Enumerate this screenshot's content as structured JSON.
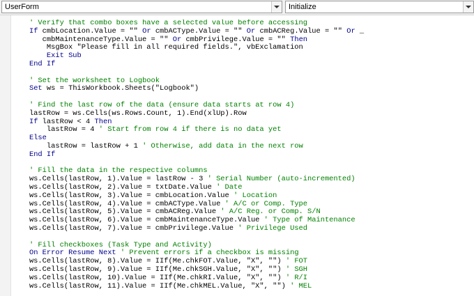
{
  "object_box": {
    "value": "UserForm"
  },
  "procedure_box": {
    "value": "Initialize"
  },
  "code_lines": [
    [
      {
        "t": "    "
      },
      {
        "t": "' Verify that combo boxes have a selected value before accessing",
        "c": "cm"
      }
    ],
    [
      {
        "t": "    "
      },
      {
        "t": "If",
        "c": "kw"
      },
      {
        "t": " cmbLocation.Value = \"\" "
      },
      {
        "t": "Or",
        "c": "kw"
      },
      {
        "t": " cmbACType.Value = \"\" "
      },
      {
        "t": "Or",
        "c": "kw"
      },
      {
        "t": " cmbACReg.Value = \"\" "
      },
      {
        "t": "Or",
        "c": "kw"
      },
      {
        "t": " _"
      }
    ],
    [
      {
        "t": "       cmbMaintenanceType.Value = \"\" "
      },
      {
        "t": "Or",
        "c": "kw"
      },
      {
        "t": " cmbPrivilege.Value = \"\" "
      },
      {
        "t": "Then",
        "c": "kw"
      }
    ],
    [
      {
        "t": "        MsgBox \"Please fill in all required fields.\", vbExclamation"
      }
    ],
    [
      {
        "t": "        "
      },
      {
        "t": "Exit Sub",
        "c": "kw"
      }
    ],
    [
      {
        "t": "    "
      },
      {
        "t": "End If",
        "c": "kw"
      }
    ],
    [
      {
        "t": ""
      }
    ],
    [
      {
        "t": "    "
      },
      {
        "t": "' Set the worksheet to Logbook",
        "c": "cm"
      }
    ],
    [
      {
        "t": "    "
      },
      {
        "t": "Set",
        "c": "kw"
      },
      {
        "t": " ws = ThisWorkbook.Sheets(\"Logbook\")"
      }
    ],
    [
      {
        "t": ""
      }
    ],
    [
      {
        "t": "    "
      },
      {
        "t": "' Find the last row of the data (ensure data starts at row 4)",
        "c": "cm"
      }
    ],
    [
      {
        "t": "    lastRow = ws.Cells(ws.Rows.Count, 1).End(xlUp).Row"
      }
    ],
    [
      {
        "t": "    "
      },
      {
        "t": "If",
        "c": "kw"
      },
      {
        "t": " lastRow < 4 "
      },
      {
        "t": "Then",
        "c": "kw"
      }
    ],
    [
      {
        "t": "        lastRow = 4 "
      },
      {
        "t": "' Start from row 4 if there is no data yet",
        "c": "cm"
      }
    ],
    [
      {
        "t": "    "
      },
      {
        "t": "Else",
        "c": "kw"
      }
    ],
    [
      {
        "t": "        lastRow = lastRow + 1 "
      },
      {
        "t": "' Otherwise, add data in the next row",
        "c": "cm"
      }
    ],
    [
      {
        "t": "    "
      },
      {
        "t": "End If",
        "c": "kw"
      }
    ],
    [
      {
        "t": ""
      }
    ],
    [
      {
        "t": "    "
      },
      {
        "t": "' Fill the data in the respective columns",
        "c": "cm"
      }
    ],
    [
      {
        "t": "    ws.Cells(lastRow, 1).Value = lastRow - 3 "
      },
      {
        "t": "' Serial Number (auto-incremented)",
        "c": "cm"
      }
    ],
    [
      {
        "t": "    ws.Cells(lastRow, 2).Value = txtDate.Value "
      },
      {
        "t": "' Date",
        "c": "cm"
      }
    ],
    [
      {
        "t": "    ws.Cells(lastRow, 3).Value = cmbLocation.Value "
      },
      {
        "t": "' Location",
        "c": "cm"
      }
    ],
    [
      {
        "t": "    ws.Cells(lastRow, 4).Value = cmbACType.Value "
      },
      {
        "t": "' A/C or Comp. Type",
        "c": "cm"
      }
    ],
    [
      {
        "t": "    ws.Cells(lastRow, 5).Value = cmbACReg.Value "
      },
      {
        "t": "' A/C Reg. or Comp. S/N",
        "c": "cm"
      }
    ],
    [
      {
        "t": "    ws.Cells(lastRow, 6).Value = cmbMaintenanceType.Value "
      },
      {
        "t": "' Type of Maintenance",
        "c": "cm"
      }
    ],
    [
      {
        "t": "    ws.Cells(lastRow, 7).Value = cmbPrivilege.Value "
      },
      {
        "t": "' Privilege Used",
        "c": "cm"
      }
    ],
    [
      {
        "t": ""
      }
    ],
    [
      {
        "t": "    "
      },
      {
        "t": "' Fill checkboxes (Task Type and Activity)",
        "c": "cm"
      }
    ],
    [
      {
        "t": "    "
      },
      {
        "t": "On Error Resume Next",
        "c": "kw"
      },
      {
        "t": " "
      },
      {
        "t": "' Prevent errors if a checkbox is missing",
        "c": "cm"
      }
    ],
    [
      {
        "t": "    ws.Cells(lastRow, 8).Value = IIf(Me.chkFOT.Value, \"X\", \"\") "
      },
      {
        "t": "' FOT",
        "c": "cm"
      }
    ],
    [
      {
        "t": "    ws.Cells(lastRow, 9).Value = IIf(Me.chkSGH.Value, \"X\", \"\") "
      },
      {
        "t": "' SGH",
        "c": "cm"
      }
    ],
    [
      {
        "t": "    ws.Cells(lastRow, 10).Value = IIf(Me.chkRI.Value, \"X\", \"\") "
      },
      {
        "t": "' R/I",
        "c": "cm"
      }
    ],
    [
      {
        "t": "    ws.Cells(lastRow, 11).Value = IIf(Me.chkMEL.Value, \"X\", \"\") "
      },
      {
        "t": "' MEL",
        "c": "cm"
      }
    ]
  ]
}
